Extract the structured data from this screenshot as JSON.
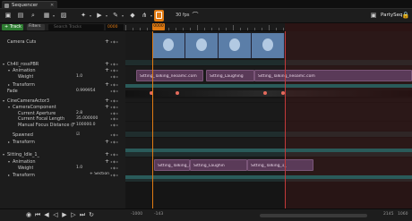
{
  "tab": {
    "title": "Sequencer",
    "close": "✕"
  },
  "toolbar": {
    "icons": [
      "save-icon",
      "browse-icon",
      "find-icon",
      "film-icon",
      "render-icon",
      "settings-icon",
      "playback-icon",
      "key-icon",
      "snap-icon",
      "camera-lock-icon",
      "curve-icon"
    ],
    "fps": "30 fps",
    "sequence_name": "PartySeq"
  },
  "header": {
    "track_button": "+ Track",
    "filters_button": "Filters",
    "search_placeholder": "Search Tracks",
    "frame": "0000"
  },
  "tracks": [
    {
      "name": "Camera Cuts",
      "chev": "",
      "indent": 8,
      "plus": "+"
    },
    {
      "name": "Ch4ll_rossPBR",
      "chev": "▾",
      "indent": 8,
      "plus": "+"
    },
    {
      "name": "Animation",
      "chev": "▾",
      "indent": 14,
      "plus": "+"
    },
    {
      "name": "Weight",
      "chev": "",
      "indent": 20,
      "value": "1.0"
    },
    {
      "name": "Transform",
      "chev": "▸",
      "indent": 14,
      "plus": "+"
    },
    {
      "name": "Fade",
      "chev": "",
      "indent": 8,
      "value": "0.999954"
    },
    {
      "name": "CineCameraActor3",
      "chev": "▾",
      "indent": 8,
      "plus": "+"
    },
    {
      "name": "CameraComponent",
      "chev": "▾",
      "indent": 14,
      "plus": "+"
    },
    {
      "name": "Current Aperture",
      "chev": "",
      "indent": 20,
      "value": "2.8"
    },
    {
      "name": "Current Focal Length",
      "chev": "",
      "indent": 20,
      "value": "35.000000"
    },
    {
      "name": "Manual Focus Distance (Focus Sett",
      "chev": "",
      "indent": 20,
      "value": "100000.0"
    },
    {
      "name": "Spawned",
      "chev": "",
      "indent": 14,
      "value": "☑"
    },
    {
      "name": "Transform",
      "chev": "▸",
      "indent": 14,
      "plus": "+"
    },
    {
      "name": "Sitting_Idle_1_",
      "chev": "▾",
      "indent": 8,
      "plus": "+"
    },
    {
      "name": "Animation",
      "chev": "▾",
      "indent": 14,
      "plus": "+"
    },
    {
      "name": "Weight",
      "chev": "",
      "indent": 20,
      "value": "1.0"
    },
    {
      "name": "Transform",
      "chev": "▸",
      "indent": 14,
      "plus": "+ Section"
    }
  ],
  "sections": [
    {
      "label": "Sitting_Talking_neoamc.com"
    },
    {
      "label": "Sitting_Laughing"
    },
    {
      "label": "Sitting_Talking_neoamc.com"
    },
    {
      "label": "Sitting_Talking_1_"
    },
    {
      "label": "Sitting_Laughin"
    },
    {
      "label": "Sitting_Talking_1_"
    }
  ],
  "bottom": {
    "start": "-1000",
    "current": "-143",
    "end": "2145",
    "end2": "1060"
  }
}
